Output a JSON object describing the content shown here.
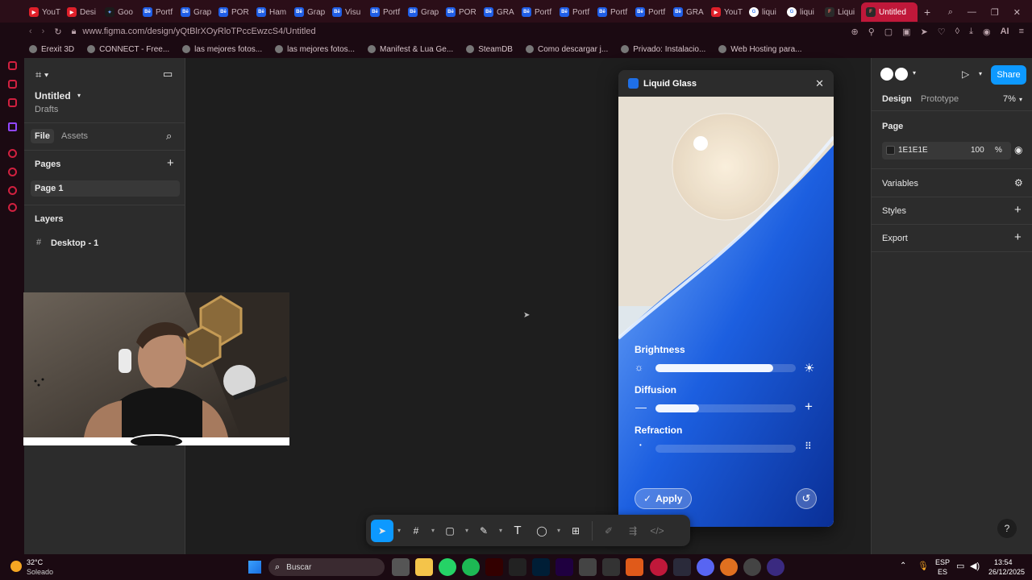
{
  "browser": {
    "tabs": [
      {
        "label": "YouT",
        "icon": "youtube-icon"
      },
      {
        "label": "Desi",
        "icon": "youtube-icon"
      },
      {
        "label": "Goo",
        "icon": "gemini-icon"
      },
      {
        "label": "Portf",
        "icon": "behance-icon"
      },
      {
        "label": "Grap",
        "icon": "behance-icon"
      },
      {
        "label": "POR",
        "icon": "behance-icon"
      },
      {
        "label": "Ham",
        "icon": "behance-icon"
      },
      {
        "label": "Grap",
        "icon": "behance-icon"
      },
      {
        "label": "Visu",
        "icon": "behance-icon"
      },
      {
        "label": "Portf",
        "icon": "behance-icon"
      },
      {
        "label": "Grap",
        "icon": "behance-icon"
      },
      {
        "label": "POR",
        "icon": "behance-icon"
      },
      {
        "label": "GRA",
        "icon": "behance-icon"
      },
      {
        "label": "Portf",
        "icon": "behance-icon"
      },
      {
        "label": "Portf",
        "icon": "behance-icon"
      },
      {
        "label": "Portf",
        "icon": "behance-icon"
      },
      {
        "label": "Portf",
        "icon": "behance-icon"
      },
      {
        "label": "GRA",
        "icon": "behance-icon"
      },
      {
        "label": "YouT",
        "icon": "youtube-icon"
      },
      {
        "label": "liqui",
        "icon": "google-icon"
      },
      {
        "label": "liqui",
        "icon": "google-icon"
      },
      {
        "label": "Liqui",
        "icon": "figma-icon"
      }
    ],
    "active_tab": "Untitled",
    "url": "www.figma.com/design/yQtBlrXOyRloTPccEwzcS4/Untitled",
    "bookmarks": [
      "Erexit 3D",
      "CONNECT - Free...",
      "las mejores fotos...",
      "las mejores fotos...",
      "Manifest & Lua Ge...",
      "SteamDB",
      "Como descargar j...",
      "Privado: Instalacio...",
      "Web Hosting para..."
    ]
  },
  "figma": {
    "file_name": "Untitled",
    "location": "Drafts",
    "tabs": {
      "file": "File",
      "assets": "Assets"
    },
    "pages_label": "Pages",
    "pages": [
      "Page 1"
    ],
    "layers_label": "Layers",
    "layers": [
      "Desktop - 1"
    ],
    "right": {
      "share": "Share",
      "design_tab": "Design",
      "prototype_tab": "Prototype",
      "zoom": "7%",
      "page_label": "Page",
      "page_color": "1E1E1E",
      "page_opacity": "100",
      "percent": "%",
      "variables": "Variables",
      "styles": "Styles",
      "export": "Export"
    },
    "plugin": {
      "title": "Liquid Glass",
      "sliders": [
        {
          "label": "Brightness",
          "value": 0.84
        },
        {
          "label": "Diffusion",
          "value": 0.31
        },
        {
          "label": "Refraction",
          "value": 0.0
        }
      ],
      "apply": "Apply"
    },
    "help": "?"
  },
  "taskbar": {
    "weather_temp": "32°C",
    "weather_desc": "Soleado",
    "search": "Buscar",
    "lang_top": "ESP",
    "lang_bottom": "ES",
    "time": "13:54",
    "date": "26/12/2025"
  },
  "colors": {
    "accent": "#0d99ff",
    "brand": "#c0183a",
    "share": "#0d99ff"
  }
}
